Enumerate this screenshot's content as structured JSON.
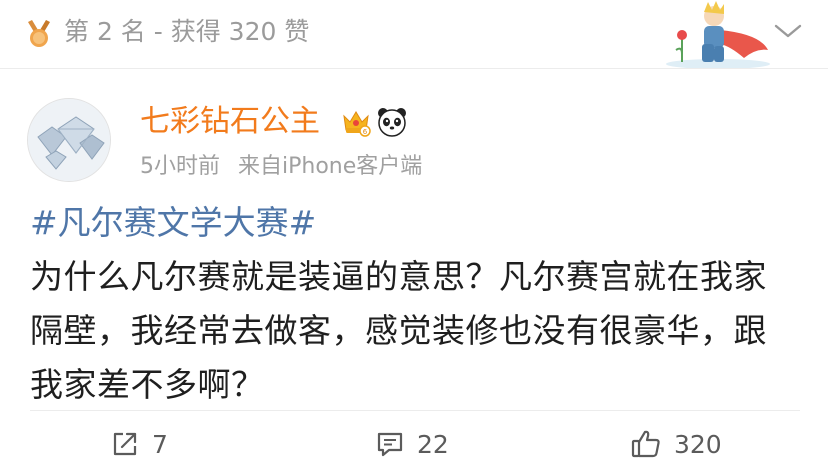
{
  "rank": {
    "text": "第 2 名 - 获得 320 赞"
  },
  "post": {
    "username": "七彩钻石公主",
    "time": "5小时前",
    "source": "来自iPhone客户端",
    "topic": "#凡尔赛文学大赛#",
    "content_lines": [
      "为什么凡尔赛就是装逼的意思？凡尔赛宫就在我家",
      "隔壁，我经常去做客，感觉装修也没有很豪华，跟",
      "我家差不多啊？"
    ]
  },
  "actions": {
    "share_count": "7",
    "comment_count": "22",
    "like_count": "320"
  },
  "icons": {
    "medal": "medal-icon",
    "prince": "little-prince-illustration",
    "chevron": "chevron-down-icon",
    "crown": "crown-badge-icon",
    "panda": "panda-badge-icon",
    "share": "share-icon",
    "comment": "comment-icon",
    "like": "thumbs-up-icon"
  },
  "colors": {
    "username": "#f27b1c",
    "topic": "#4f76a8",
    "meta": "#a0a0a0",
    "rank_text": "#9b9b9b"
  }
}
